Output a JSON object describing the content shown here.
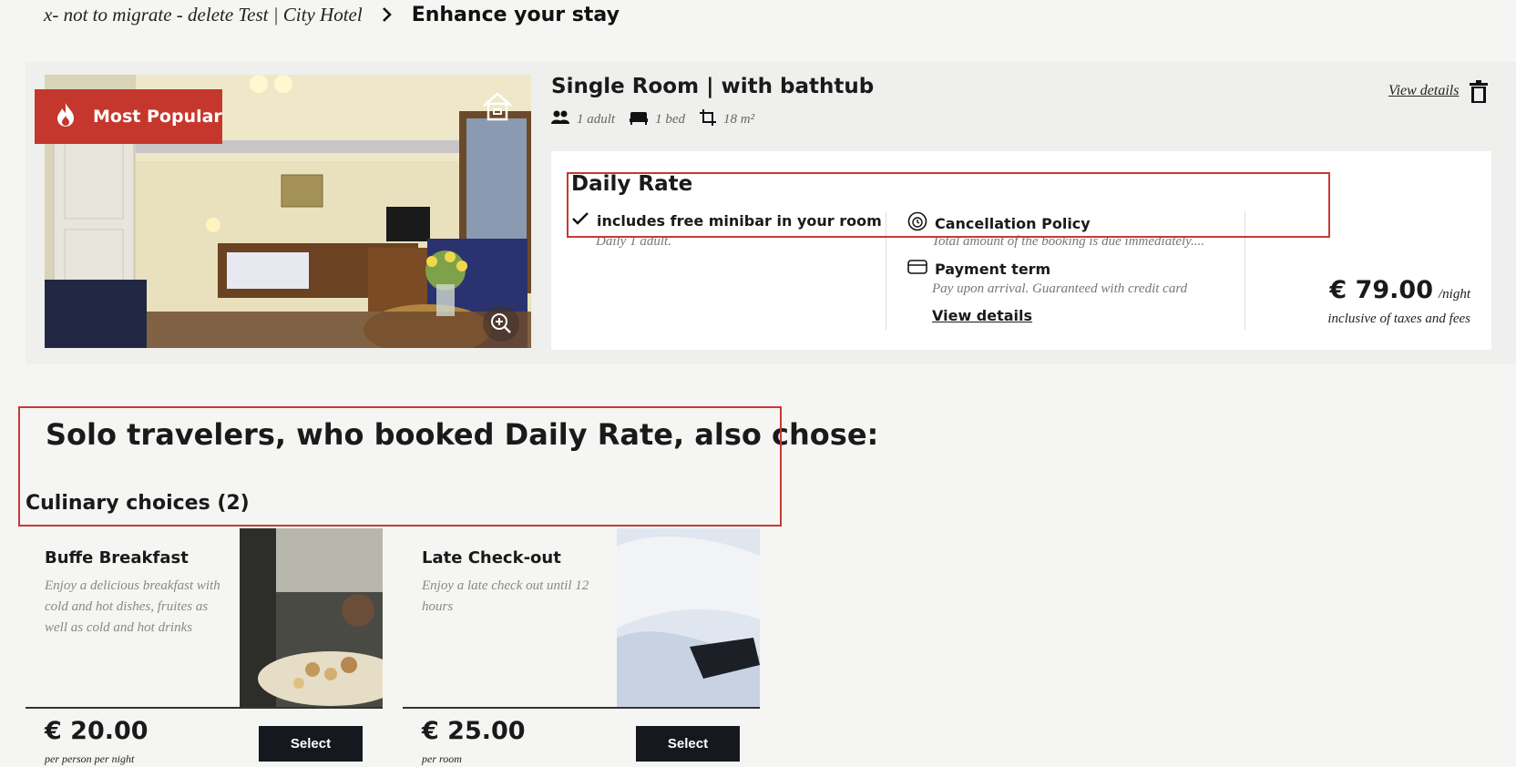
{
  "breadcrumb": {
    "hotel": "x- not to migrate - delete Test | City Hotel",
    "current": "Enhance your stay"
  },
  "room": {
    "badge": "Most Popular",
    "title": "Single Room | with bathtub",
    "guests": "1 adult",
    "beds": "1 bed",
    "size": "18 m²",
    "view_details": "View details"
  },
  "rate": {
    "name": "Daily Rate",
    "includes": "includes free minibar in your room",
    "includes_sub": "Daily 1 adult.",
    "cancellation_title": "Cancellation Policy",
    "cancellation_text": "Total amount of the booking is due immediately....",
    "payment_title": "Payment term",
    "payment_text": "Pay upon arrival. Guaranteed with credit card",
    "view_details": "View details",
    "price": "€ 79.00",
    "price_unit": "/night",
    "price_note": "inclusive of taxes and fees"
  },
  "upsell": {
    "heading": "Solo travelers, who booked Daily Rate, also chose:",
    "category": "Culinary choices (2)",
    "items": [
      {
        "title": "Buffe Breakfast",
        "description": "Enjoy a delicious breakfast with cold and hot dishes, fruites as well as cold and hot drinks",
        "price": "€ 20.00",
        "unit": "per person per night",
        "button": "Select"
      },
      {
        "title": "Late Check-out",
        "description": "Enjoy a late check out until 12 hours",
        "price": "€ 25.00",
        "unit": "per room",
        "button": "Select"
      }
    ]
  },
  "colors": {
    "accent_red": "#c5372c",
    "button_dark": "#15181f",
    "background": "#f5f5f3"
  },
  "icons": [
    "chevron-right-icon",
    "flame-icon",
    "home-icon",
    "zoom-in-icon",
    "guests-icon",
    "bed-icon",
    "size-icon",
    "trash-icon",
    "check-icon",
    "cancellation-icon",
    "credit-card-icon"
  ]
}
